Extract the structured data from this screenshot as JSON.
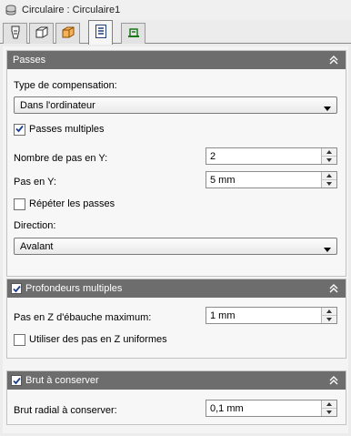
{
  "window": {
    "title": "Circulaire : Circulaire1"
  },
  "tabs": [
    {
      "icon": "tool-icon"
    },
    {
      "icon": "stock-box-icon"
    },
    {
      "icon": "heights-icon"
    },
    {
      "icon": "passes-icon"
    },
    {
      "icon": "linking-icon"
    }
  ],
  "passes": {
    "header": "Passes",
    "compensation_label": "Type de compensation:",
    "compensation_value": "Dans l'ordinateur",
    "multiple_passes_label": "Passes multiples",
    "multiple_passes_checked": true,
    "y_steps_label": "Nombre de pas en Y:",
    "y_steps_value": "2",
    "y_step_label": "Pas en Y:",
    "y_step_value": "5 mm",
    "repeat_label": "Répéter les passes",
    "repeat_checked": false,
    "direction_label": "Direction:",
    "direction_value": "Avalant"
  },
  "depths": {
    "header": "Profondeurs multiples",
    "enabled": true,
    "max_z_label": "Pas en Z d'ébauche maximum:",
    "max_z_value": "1 mm",
    "uniform_label": "Utiliser des pas en Z uniformes",
    "uniform_checked": false
  },
  "stock": {
    "header": "Brut à conserver",
    "enabled": true,
    "radial_label": "Brut radial à conserver:",
    "radial_value": "0,1 mm"
  }
}
